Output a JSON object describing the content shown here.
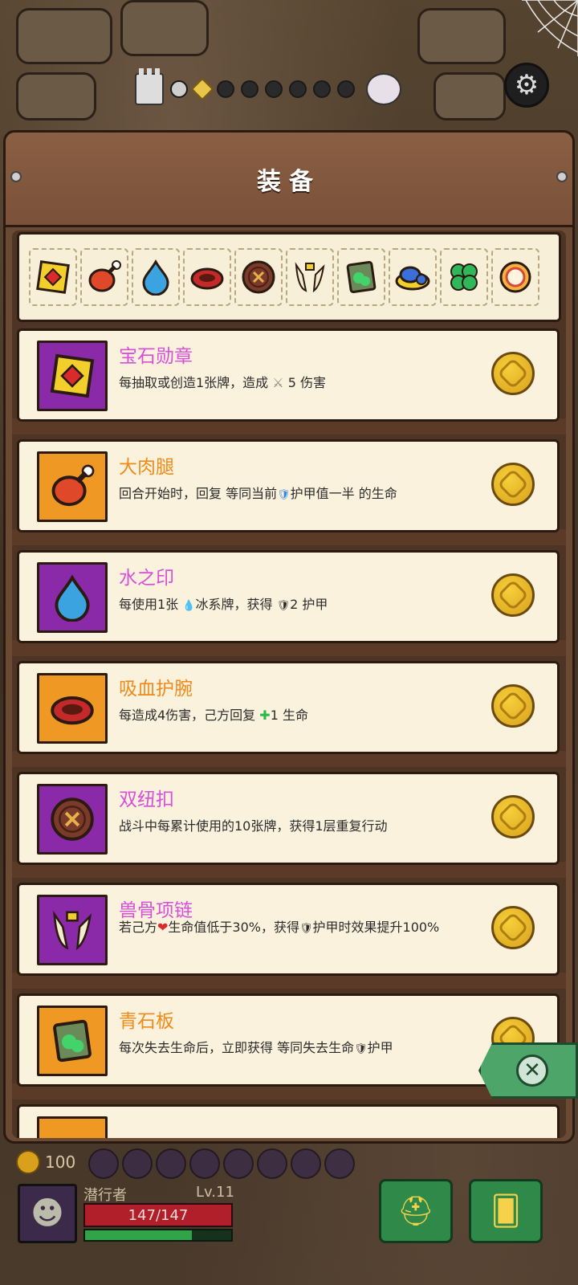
{
  "screen": {
    "title": "装备",
    "accent_colors": {
      "purple_frame": "#8a2aa8",
      "orange_frame": "#f09824",
      "purple_name": "#d94fd9",
      "orange_name": "#f08a18"
    }
  },
  "progress": {
    "nodes": [
      "castle",
      "done",
      "current",
      "pending",
      "pending",
      "pending",
      "pending",
      "pending",
      "pending",
      "boss"
    ]
  },
  "equipment_bar": {
    "icons": [
      "gem-medal-icon",
      "meat-leg-icon",
      "water-seal-icon",
      "vampire-bracer-icon",
      "double-button-icon",
      "beast-bone-necklace-icon",
      "green-slate-icon",
      "blue-mushroom-icon",
      "four-leaf-clover-icon",
      "ring-icon"
    ]
  },
  "items": [
    {
      "name": "宝石勋章",
      "rarity": "purple",
      "icon": "gem-medal-icon",
      "desc_parts": [
        "每抽取或创造1张牌，造成",
        "⚔",
        "5 伤害"
      ]
    },
    {
      "name": "大肉腿",
      "rarity": "orange",
      "icon": "meat-leg-icon",
      "desc_parts": [
        "回合开始时，回复 等同当前",
        "🛡",
        "护甲值一半 的生命"
      ]
    },
    {
      "name": "水之印",
      "rarity": "purple",
      "icon": "water-seal-icon",
      "desc_parts": [
        "每使用1张 ",
        "💧",
        "冰系牌，获得 ",
        "🛡",
        "2 护甲"
      ]
    },
    {
      "name": "吸血护腕",
      "rarity": "orange",
      "icon": "vampire-bracer-icon",
      "desc_parts": [
        "每造成4伤害，己方回复 ",
        "✚",
        "1 生命"
      ]
    },
    {
      "name": "双纽扣",
      "rarity": "purple",
      "icon": "double-button-icon",
      "desc_parts": [
        "战斗中每累计使用的10张牌，获得1层重复行动"
      ]
    },
    {
      "name": "兽骨项链",
      "rarity": "purple",
      "icon": "beast-bone-necklace-icon",
      "desc_parts": [
        "若己方",
        "❤",
        "生命值低于30%，获得",
        "🛡",
        "护甲时效果提升100%"
      ]
    },
    {
      "name": "青石板",
      "rarity": "orange",
      "icon": "green-slate-icon",
      "desc_parts": [
        "每次失去生命后，立即获得 等同失去生命",
        "🛡",
        "护甲"
      ]
    }
  ],
  "hud": {
    "gold": "100",
    "player_name": "潜行者",
    "level": "Lv.11",
    "hp": "147/147",
    "xp_fraction": 0.73,
    "icons": {
      "avatar": "rogue-avatar-icon",
      "btn1": "viking-helmet-icon",
      "btn2": "card-deck-icon",
      "close": "close-icon",
      "settings": "gear-icon"
    }
  }
}
